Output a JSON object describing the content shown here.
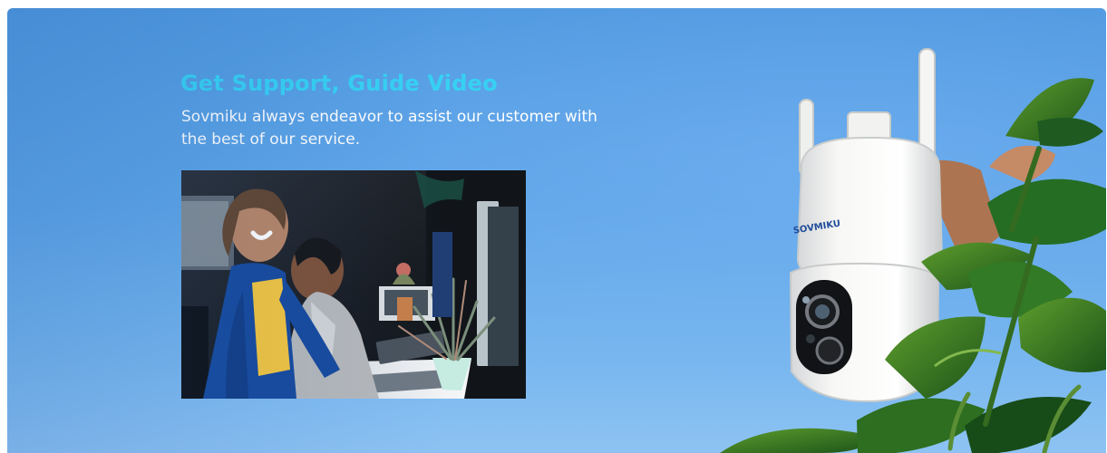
{
  "banner": {
    "title": "Get Support, Guide Video",
    "description": "Sovmiku always endeavor to assist our customer with the best of our service.",
    "photo_subject": "support-team-photo",
    "product_subject": "security-camera-photo",
    "camera_logo": "SOVMIKU",
    "colors": {
      "sky": "#5ea5e7",
      "headline": "#36d1f3",
      "body_text": "#ffffff"
    }
  }
}
